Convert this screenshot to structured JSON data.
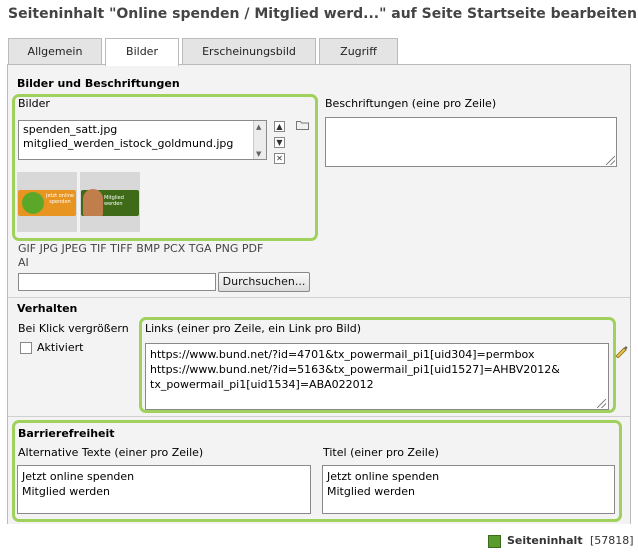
{
  "title": "Seiteninhalt \"Online spenden / Mitglied werd...\" auf Seite Startseite bearbeiten",
  "tabs": [
    "Allgemein",
    "Bilder",
    "Erscheinungsbild",
    "Zugriff"
  ],
  "bilder_section": {
    "heading": "Bilder und Beschriftungen",
    "bilder_label": "Bilder",
    "files": [
      "spenden_satt.jpg",
      "mitglied_werden_istock_goldmund.jpg"
    ],
    "thumb1_text": "Jetzt online spenden",
    "thumb2_text": "Mitglied werden",
    "captions_label": "Beschriftungen (eine pro Zeile)",
    "captions_value": "",
    "filetypes": "GIF JPG JPEG TIF TIFF BMP PCX TGA PNG PDF AI",
    "upload_value": "",
    "browse_button": "Durchsuchen..."
  },
  "verhalten": {
    "heading": "Verhalten",
    "click_enlarge_label": "Bei Klick vergrößern",
    "activated_label": "Aktiviert",
    "activated": false,
    "links_label": "Links (einer pro Zeile, ein Link pro Bild)",
    "links_value": "https://www.bund.net/?id=4701&tx_powermail_pi1[uid304]=permbox\nhttps://www.bund.net/?id=5163&tx_powermail_pi1[uid1527]=AHBV2012&\ntx_powermail_pi1[uid1534]=ABA022012"
  },
  "barriere": {
    "heading": "Barrierefreiheit",
    "alt_label": "Alternative Texte (einer pro Zeile)",
    "alt_value": "Jetzt online spenden\nMitglied werden",
    "title_label": "Titel (einer pro Zeile)",
    "title_value": "Jetzt online spenden\nMitglied werden"
  },
  "footer": {
    "record_label": "Seiteninhalt",
    "record_id": "[57818]"
  }
}
